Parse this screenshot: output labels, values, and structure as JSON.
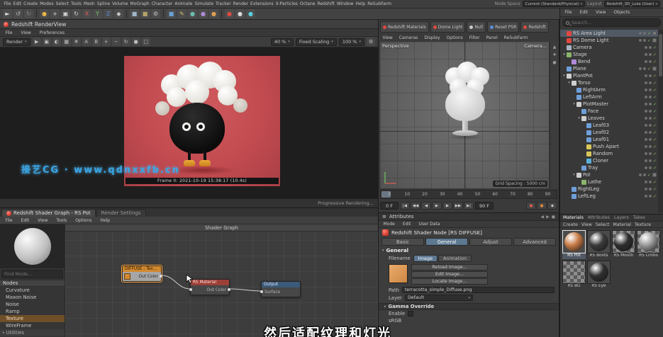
{
  "menubar": {
    "items": [
      "File",
      "Edit",
      "Create",
      "Modes",
      "Select",
      "Tools",
      "Mesh",
      "Spline",
      "Volume",
      "MoGraph",
      "Character",
      "Animate",
      "Simulate",
      "Tracker",
      "Render",
      "Extensions",
      "X-Particles",
      "Octane",
      "Redshift",
      "Window",
      "Help",
      "ReSubFarm"
    ],
    "node_space_label": "Node Space",
    "node_space_value": "Current (Standard/Physical)",
    "layout_label": "Layout",
    "layout_value": "Redshift_3D_Luke (User)"
  },
  "toolbar": {
    "icons": [
      {
        "name": "cursor-icon",
        "glyph": "►",
        "color": "#e6e6e6"
      },
      {
        "name": "undo-icon",
        "glyph": "↺",
        "color": "#c0c0c0"
      },
      {
        "name": "redo-icon",
        "glyph": "↻",
        "color": "#8a8a8a"
      },
      {
        "name": "divider",
        "glyph": "",
        "color": ""
      },
      {
        "name": "live-selection-icon",
        "glyph": "●",
        "color": "#e8b24a"
      },
      {
        "name": "move-tool-icon",
        "glyph": "+",
        "color": "#d8d8d8"
      },
      {
        "name": "scale-tool-icon",
        "glyph": "▣",
        "color": "#d8d8d8"
      },
      {
        "name": "rotate-tool-icon",
        "glyph": "↻",
        "color": "#d8d8d8"
      },
      {
        "name": "x-axis-lock-icon",
        "glyph": "X",
        "color": "#e05a50"
      },
      {
        "name": "y-axis-lock-icon",
        "glyph": "Y",
        "color": "#77c06a"
      },
      {
        "name": "z-axis-lock-icon",
        "glyph": "Z",
        "color": "#5a8fd9"
      },
      {
        "name": "coordinate-system-icon",
        "glyph": "◆",
        "color": "#c8c8c8"
      },
      {
        "name": "divider",
        "glyph": "",
        "color": ""
      },
      {
        "name": "render-view-icon",
        "glyph": "■",
        "color": "#9fb6c9"
      },
      {
        "name": "render-active-view-icon",
        "glyph": "■",
        "color": "#b6a06a"
      },
      {
        "name": "render-settings-icon",
        "glyph": "⚙",
        "color": "#c0c0c0"
      },
      {
        "name": "divider",
        "glyph": "",
        "color": ""
      },
      {
        "name": "primitive-cube-icon",
        "glyph": "■",
        "color": "#6aa0d8"
      },
      {
        "name": "spline-pen-icon",
        "glyph": "✎",
        "color": "#d8c06a"
      },
      {
        "name": "mograph-icon",
        "glyph": "●",
        "color": "#6ac0b0"
      },
      {
        "name": "volume-icon",
        "glyph": "●",
        "color": "#b08ad9"
      },
      {
        "name": "field-icon",
        "glyph": "●",
        "color": "#e0a050"
      },
      {
        "name": "divider",
        "glyph": "",
        "color": ""
      },
      {
        "name": "redshift-icon",
        "glyph": "●",
        "color": "#e0493f"
      },
      {
        "name": "octane-icon",
        "glyph": "●",
        "color": "#d8d8d8"
      },
      {
        "name": "xparticles-icon",
        "glyph": "●",
        "color": "#5ad0e0"
      }
    ]
  },
  "renderview": {
    "tab_label": "Redshift RenderView",
    "menus": [
      "File",
      "View",
      "Preferences"
    ],
    "render_select": "Render",
    "tool_icons": [
      {
        "name": "start-ipr-icon",
        "glyph": "▶"
      },
      {
        "name": "snapshot-icon",
        "glyph": "▣"
      },
      {
        "name": "ab-compare-icon",
        "glyph": "◐"
      },
      {
        "name": "checker-background-icon",
        "glyph": "▦"
      },
      {
        "name": "freeze-icon",
        "glyph": "❄"
      },
      {
        "name": "channel-a-icon",
        "glyph": "A"
      },
      {
        "name": "channel-b-icon",
        "glyph": "B"
      },
      {
        "name": "zoom-in-icon",
        "glyph": "+"
      },
      {
        "name": "zoom-out-icon",
        "glyph": "−"
      },
      {
        "name": "refresh-icon",
        "glyph": "↻"
      },
      {
        "name": "color-sample-icon",
        "glyph": "●"
      },
      {
        "name": "region-render-icon",
        "glyph": "□"
      }
    ],
    "zoom_value": "40 %",
    "scaling_mode": "Fixed Scaling",
    "scale_value": "100 %",
    "frame_info": "Frame 0: 2021-10-19 15:38:17 (10.4s)",
    "progressive_label": "Progressive Rendering...",
    "watermark": "接艺CG · www.qdnxxfb.cn"
  },
  "viewport": {
    "toolbar_buttons": [
      {
        "label": "Redshift Materials",
        "icon_color": "#e0493f"
      },
      {
        "label": "Dome Light",
        "icon_color": "#e0493f"
      },
      {
        "label": "Null",
        "icon_color": "#c8c8c8"
      },
      {
        "label": "Reset PSR",
        "icon_color": "#5a8fd9"
      },
      {
        "label": "Redshift",
        "icon_color": "#e0493f"
      }
    ],
    "menus": [
      "View",
      "Cameras",
      "Display",
      "Options",
      "Filter",
      "Panel",
      "ReSubFarm"
    ],
    "view_label": "Perspective",
    "camera_label": "Camera...",
    "grid_spacing": "Grid Spacing : 5000 cm",
    "timeline_ticks": [
      "0",
      "10",
      "20",
      "30",
      "40",
      "50",
      "60",
      "70",
      "80",
      "90"
    ],
    "current_frame": "0 F",
    "end_frame": "90 F",
    "transport": [
      {
        "name": "goto-start-button",
        "glyph": "|◀"
      },
      {
        "name": "prev-key-button",
        "glyph": "◀◀"
      },
      {
        "name": "prev-frame-button",
        "glyph": "◀"
      },
      {
        "name": "play-button",
        "glyph": "▶"
      },
      {
        "name": "next-frame-button",
        "glyph": "▶"
      },
      {
        "name": "next-key-button",
        "glyph": "▶▶"
      },
      {
        "name": "goto-end-button",
        "glyph": "▶|"
      }
    ],
    "record_buttons": [
      {
        "name": "record-keyframe-button",
        "glyph": "●",
        "color": "#e05a50"
      },
      {
        "name": "autokey-button",
        "glyph": "●",
        "color": "#e08a3f"
      },
      {
        "name": "keyframe-selection-button",
        "glyph": "◆",
        "color": "#c8c8c8"
      }
    ]
  },
  "object_manager": {
    "menus": [
      "File",
      "Edit",
      "View",
      "Objects"
    ],
    "search_placeholder": "Search...",
    "items": [
      {
        "label": "RS Area Light",
        "depth": 0,
        "color": "#e0493f",
        "selected": true,
        "tag": true
      },
      {
        "label": "RS Dome Light",
        "depth": 0,
        "color": "#e0493f",
        "tag": true
      },
      {
        "label": "Camera",
        "depth": 0,
        "color": "#a8b4c0"
      },
      {
        "label": "Stage",
        "depth": 0,
        "color": "#8ab56a",
        "expand": true
      },
      {
        "label": "Bend",
        "depth": 1,
        "color": "#b08ad9"
      },
      {
        "label": "Plane",
        "depth": 0,
        "color": "#6f9fd9",
        "tag": true
      },
      {
        "label": "PlantPot",
        "depth": 0,
        "color": "#cfcfcf",
        "expand": true
      },
      {
        "label": "Torso",
        "depth": 1,
        "color": "#cfcfcf",
        "expand": true
      },
      {
        "label": "RightArm",
        "depth": 2,
        "color": "#6f9fd9"
      },
      {
        "label": "LeftArm",
        "depth": 2,
        "color": "#6f9fd9"
      },
      {
        "label": "PlotMaster",
        "depth": 2,
        "color": "#cfcfcf",
        "expand": true
      },
      {
        "label": "Face",
        "depth": 3,
        "color": "#6f9fd9"
      },
      {
        "label": "Leaves",
        "depth": 3,
        "color": "#cfcfcf",
        "expand": true
      },
      {
        "label": "Leaf03",
        "depth": 4,
        "color": "#6f9fd9"
      },
      {
        "label": "Leaf02",
        "depth": 4,
        "color": "#6f9fd9"
      },
      {
        "label": "Leaf01",
        "depth": 4,
        "color": "#6f9fd9"
      },
      {
        "label": "Push Apart",
        "depth": 4,
        "color": "#d9c75a"
      },
      {
        "label": "Random",
        "depth": 4,
        "color": "#d9c75a"
      },
      {
        "label": "Cloner",
        "depth": 4,
        "color": "#5ab0d9"
      },
      {
        "label": "Tray",
        "depth": 3,
        "color": "#6f9fd9"
      },
      {
        "label": "Pot",
        "depth": 2,
        "color": "#cfcfcf",
        "expand": true,
        "tag": true
      },
      {
        "label": "Lathe",
        "depth": 3,
        "color": "#8ab56a"
      },
      {
        "label": "RightLeg",
        "depth": 1,
        "color": "#6f9fd9"
      },
      {
        "label": "LeftLeg",
        "depth": 1,
        "color": "#6f9fd9"
      }
    ]
  },
  "shader_graph": {
    "tab_label": "Redshift Shader Graph - RS Pot",
    "tab2_label": "Render Settings",
    "menus": [
      "File",
      "Edit",
      "View",
      "Tools",
      "Options",
      "Help"
    ],
    "canvas_title": "Shader Graph",
    "search_placeholder": "Find Mode...",
    "nodes_header": "Nodes",
    "node_list": [
      {
        "label": "Curvature"
      },
      {
        "label": "Maxon Noise"
      },
      {
        "label": "Noise"
      },
      {
        "label": "Ramp"
      },
      {
        "label": "Texture",
        "selected": true
      },
      {
        "label": "WireFrame"
      },
      {
        "label": "Utilities",
        "group": true
      }
    ],
    "graph": {
      "texture_node": {
        "title": "DIFFUSE - Tex...",
        "out_port": "Out Color"
      },
      "material_node": {
        "title": "RS Material",
        "out_port": "Out Color"
      },
      "output_node": {
        "title": "Output",
        "in_port": "Surface"
      }
    }
  },
  "attributes": {
    "tab_label": "Attributes",
    "menus": [
      "Mode",
      "Edit",
      "User Data"
    ],
    "node_title": "Redshift Shader Node [RS DIFFUSE]",
    "tabs": [
      {
        "label": "Basic"
      },
      {
        "label": "General",
        "selected": true
      },
      {
        "label": "Adjust"
      },
      {
        "label": "Advanced"
      }
    ],
    "section_general": "General",
    "filename_label": "Filename",
    "file_mode_tabs": [
      {
        "label": "Image",
        "selected": true
      },
      {
        "label": "Animation"
      }
    ],
    "buttons": [
      "Reload Image...",
      "Edit Image...",
      "Locate Image..."
    ],
    "path_label": "Path",
    "path_value": "terracotta_simple_Diffuse.png",
    "layer_label": "Layer",
    "layer_value": "Default",
    "gamma_section": "Gamma Override",
    "enable_label": "Enable",
    "srgb_label": "sRGB",
    "swatch_color": "#dc9a58"
  },
  "materials_panel": {
    "tabs": [
      {
        "label": "Materials",
        "selected": true
      },
      {
        "label": "Attributes"
      },
      {
        "label": "Layers"
      },
      {
        "label": "Takes"
      }
    ],
    "menus": [
      "Create",
      "View",
      "Select",
      "Material",
      "Texture"
    ],
    "items": [
      {
        "label": "RS Pot",
        "color": "#c87a45",
        "selected": true
      },
      {
        "label": "RS Boots",
        "color": "#3a3a3a"
      },
      {
        "label": "RS Mouth",
        "color": "#2e2e2e",
        "checker": true
      },
      {
        "label": "RS Limbs",
        "color": "#9a9a9a",
        "checker": true
      },
      {
        "label": "RS BG",
        "color": "#8a8a8a",
        "checker": true,
        "flat": true
      },
      {
        "label": "RS Eye",
        "color": "#303030"
      }
    ]
  },
  "subtitle": "然后适配纹理和灯光"
}
